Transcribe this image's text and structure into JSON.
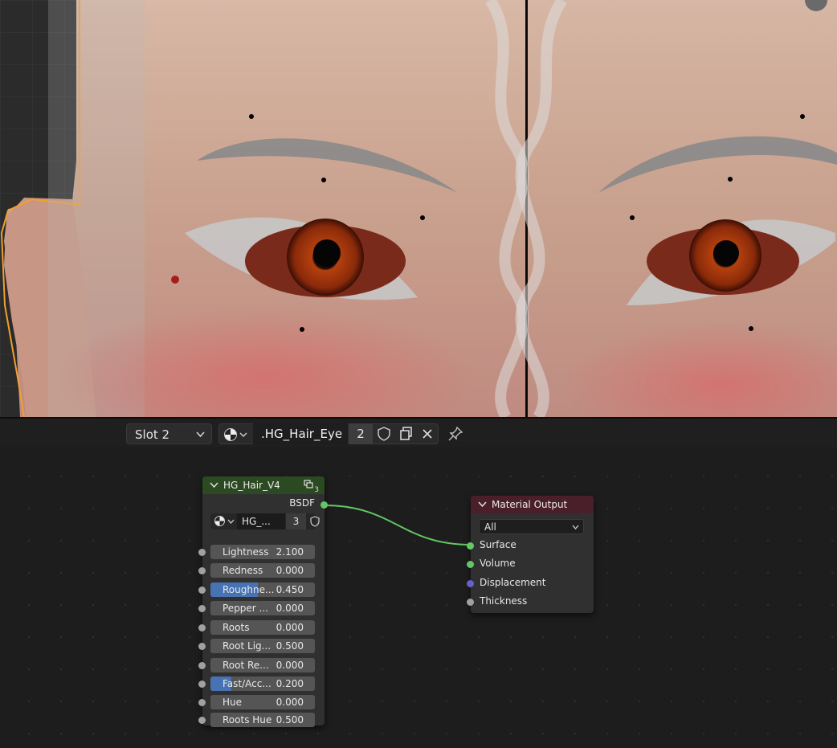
{
  "header": {
    "slot_label": "Slot 2",
    "material_name": ".HG_Hair_Eye",
    "material_users": "2"
  },
  "icons": {
    "slot_dropdown": "chevron-down-icon",
    "material_browse": "material-sphere-icon",
    "fake_user": "shield-icon",
    "duplicate": "duplicate-icon",
    "unlink": "close-icon",
    "pin": "pin-icon"
  },
  "group_node": {
    "title": "HG_Hair_V4",
    "users_badge": "3",
    "output_label": "BSDF",
    "datablock_name": "HG_...",
    "datablock_users": "3",
    "inputs": [
      {
        "label": "Lightness",
        "value": "2.100",
        "fill": 0
      },
      {
        "label": "Redness",
        "value": "0.000",
        "fill": 0
      },
      {
        "label": "Roughne...",
        "value": "0.450",
        "fill": 0.45
      },
      {
        "label": "Pepper ...",
        "value": "0.000",
        "fill": 0
      },
      {
        "label": "Roots",
        "value": "0.000",
        "fill": 0
      },
      {
        "label": "Root Lig...",
        "value": "0.500",
        "fill": 0
      },
      {
        "label": "Root Re...",
        "value": "0.000",
        "fill": 0
      },
      {
        "label": "Fast/Acc...",
        "value": "0.200",
        "fill": 0.2
      },
      {
        "label": "Hue",
        "value": "0.000",
        "fill": 0
      },
      {
        "label": "Roots Hue",
        "value": "0.500",
        "fill": 0
      }
    ]
  },
  "output_node": {
    "title": "Material Output",
    "target": "All",
    "inputs": [
      "Surface",
      "Volume",
      "Displacement",
      "Thickness"
    ]
  },
  "colors": {
    "group_header": "#2b4a22",
    "output_header": "#4a1f2a",
    "shader_socket": "#63c763",
    "vector_socket": "#6363c7",
    "float_socket": "#a1a1a1",
    "slider_fill": "#4772b3",
    "selection_outline": "#f0a030"
  }
}
